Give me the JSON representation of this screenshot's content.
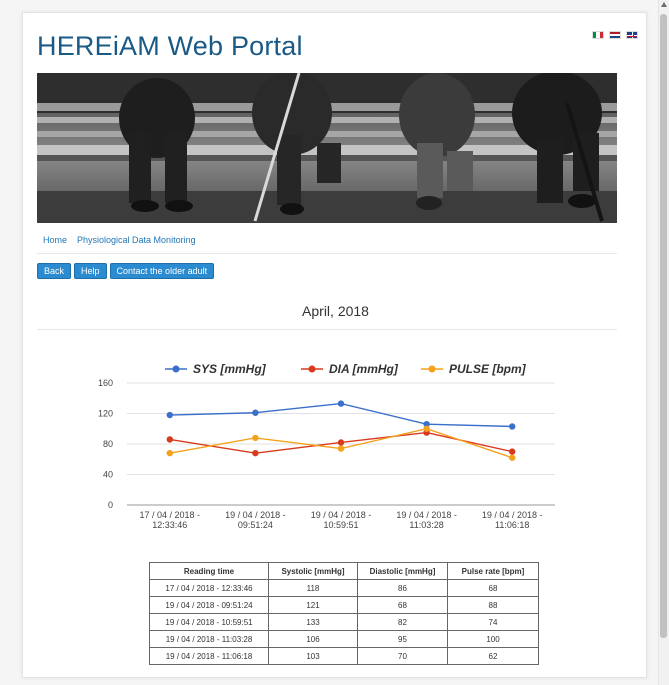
{
  "header": {
    "title": "HEREiAM Web Portal",
    "languages": [
      {
        "name": "Italian",
        "icon": "italy-flag-icon"
      },
      {
        "name": "Dutch",
        "icon": "netherlands-flag-icon"
      },
      {
        "name": "English",
        "icon": "uk-flag-icon"
      }
    ]
  },
  "breadcrumb": [
    "Home",
    "Physiological Data Monitoring"
  ],
  "buttons": {
    "back": "Back",
    "help": "Help",
    "contact": "Contact the older adult"
  },
  "month_heading": "April, 2018",
  "colors": {
    "title": "#1a5a86",
    "button": "#2a8bd0",
    "sys": "#3b6fcc",
    "dia": "#d83a1e",
    "pulse": "#f4a21b"
  },
  "chart_data": {
    "type": "line",
    "categories": [
      "17 / 04 / 2018 - 12:33:46",
      "19 / 04 / 2018 - 09:51:24",
      "19 / 04 / 2018 - 10:59:51",
      "19 / 04 / 2018 - 11:03:28",
      "19 / 04 / 2018 - 11:06:18"
    ],
    "category_lines": [
      [
        "17 / 04 / 2018 -",
        "12:33:46"
      ],
      [
        "19 / 04 / 2018 -",
        "09:51:24"
      ],
      [
        "19 / 04 / 2018 -",
        "10:59:51"
      ],
      [
        "19 / 04 / 2018 -",
        "11:03:28"
      ],
      [
        "19 / 04 / 2018 -",
        "11:06:18"
      ]
    ],
    "series": [
      {
        "name": "SYS [mmHg]",
        "values": [
          118,
          121,
          133,
          106,
          103
        ]
      },
      {
        "name": "DIA [mmHg]",
        "values": [
          86,
          68,
          82,
          95,
          70
        ]
      },
      {
        "name": "PULSE [bpm]",
        "values": [
          68,
          88,
          74,
          100,
          62
        ]
      }
    ],
    "yticks": [
      0,
      40,
      80,
      120,
      160
    ],
    "ylim": [
      0,
      160
    ],
    "legend": "top",
    "grid": true
  },
  "table": {
    "headers": [
      "Reading time",
      "Systolic [mmHg]",
      "Diastolic [mmHg]",
      "Pulse rate [bpm]"
    ],
    "rows": [
      [
        "17 / 04 / 2018 - 12:33:46",
        "118",
        "86",
        "68"
      ],
      [
        "19 / 04 / 2018 - 09:51:24",
        "121",
        "68",
        "88"
      ],
      [
        "19 / 04 / 2018 - 10:59:51",
        "133",
        "82",
        "74"
      ],
      [
        "19 / 04 / 2018 - 11:03:28",
        "106",
        "95",
        "100"
      ],
      [
        "19 / 04 / 2018 - 11:06:18",
        "103",
        "70",
        "62"
      ]
    ]
  }
}
